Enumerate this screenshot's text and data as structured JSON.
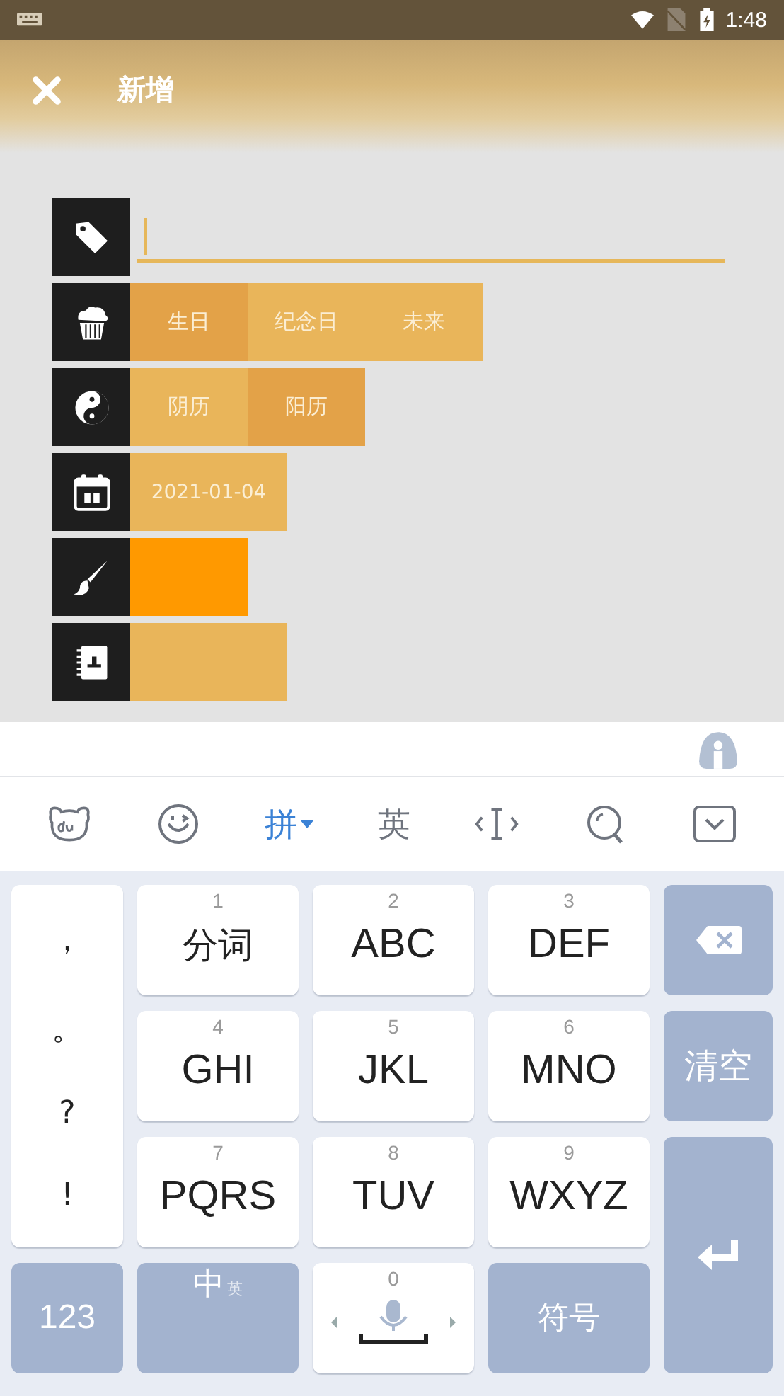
{
  "status_bar": {
    "time": "1:48"
  },
  "header": {
    "title": "新增"
  },
  "form": {
    "name_field": {
      "focused": true
    },
    "event_types": [
      {
        "label": "生日",
        "selected": true
      },
      {
        "label": "纪念日",
        "selected": false
      },
      {
        "label": "未来",
        "selected": false
      }
    ],
    "calendar_types": [
      {
        "label": "阴历",
        "selected": false
      },
      {
        "label": "阳历",
        "selected": true
      }
    ],
    "date": "2021-01-04",
    "color": "#ff9900"
  },
  "keyboard": {
    "toolbar": [
      {
        "kind": "du",
        "selected": false
      },
      {
        "kind": "emoji",
        "selected": false
      },
      {
        "kind": "text",
        "label": "拼",
        "selected": true
      },
      {
        "kind": "text",
        "label": "英",
        "selected": false
      },
      {
        "kind": "cursor",
        "selected": false
      },
      {
        "kind": "search",
        "selected": false
      },
      {
        "kind": "collapse",
        "selected": false
      }
    ],
    "punctuation": [
      "，",
      "。",
      "?",
      "!"
    ],
    "keys": [
      {
        "digit": "1",
        "label": "分词"
      },
      {
        "digit": "2",
        "label": "ABC"
      },
      {
        "digit": "3",
        "label": "DEF"
      },
      {
        "digit": "4",
        "label": "GHI"
      },
      {
        "digit": "5",
        "label": "JKL"
      },
      {
        "digit": "6",
        "label": "MNO"
      },
      {
        "digit": "7",
        "label": "PQRS"
      },
      {
        "digit": "8",
        "label": "TUV"
      },
      {
        "digit": "9",
        "label": "WXYZ"
      }
    ],
    "clear_key": "清空",
    "numbers_key": "123",
    "lang_key": {
      "main": "中",
      "sub": "英"
    },
    "space_digit": "0",
    "symbols_key": "符号"
  }
}
